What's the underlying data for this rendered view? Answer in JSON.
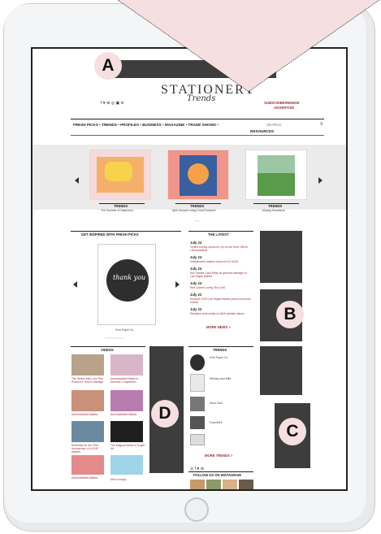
{
  "site": {
    "logo_main": "STATIONERY",
    "logo_script": "Trends",
    "subscribe": "SUBSCRIBE/RENEW",
    "advertise": "ADVERTISE",
    "social_icons": "f ♥ ⊕ ◎ ▣ in"
  },
  "nav": {
    "items": "FRESH PICKS • TRENDS • PROFILES • BUSINESS • MAGAZINE • TRADE SHOWS •",
    "resources": "RESOURCES",
    "search_placeholder": "SEARCH"
  },
  "carousel": {
    "cards": [
      {
        "tag": "TRENDS",
        "caption": "The Summer of Stationery"
      },
      {
        "tag": "TRENDS",
        "caption": "April Showers bring Coral Flowered"
      },
      {
        "tag": "TRENDS",
        "caption": "Moving Mountains"
      }
    ]
  },
  "fresh_picks": {
    "heading": "GET INSPIRED WITH FRESH PICKS",
    "card_text": "thank you",
    "caption": "Fern Paper Co."
  },
  "latest": {
    "heading": "THE LATEST",
    "items": [
      {
        "date": "July 24",
        "text": "Orders buying opens for Up on the Roof Gift for Life fundraiser"
      },
      {
        "date": "July 24",
        "text": "Independent makers return to NY NOW"
      },
      {
        "date": "July 24",
        "text": "IMC names Cara Reilly as general manager of Las Vegas Market"
      },
      {
        "date": "July 24",
        "text": "Red Queen Loving Tea Card"
      },
      {
        "date": "July 22",
        "text": "Summer 2019 Las Vegas Market plans numerous events"
      },
      {
        "date": "July 22",
        "text": "Retailers seek clarity on ADA website claims"
      }
    ],
    "more": "MORE NEWS »"
  },
  "videos": {
    "heading": "VIDEOS",
    "captions": [
      "The Hearts that Love Red Roses for How to Manage",
      "AmericasMart Made in America Competition",
      "AmericasMart Atlanta",
      "AmericasMart Atlanta",
      "Nominate for the 20th Anniversary of LOUIE awards",
      "The Magical World of Sugar Art",
      "AmericasMart Atlanta",
      "Meri Lovejoy"
    ]
  },
  "trends": {
    "heading": "TRENDS",
    "items": [
      "Fern Paper Co.",
      "Whimsy and Wild",
      "Aeon Cars",
      "FrancWell"
    ],
    "more": "MORE TRENDS »",
    "social": "◎ f ♥ ⊕"
  },
  "instagram": {
    "heading": "FOLLOW US ON INSTAGRAM"
  },
  "badges": {
    "a": "A",
    "b": "B",
    "c": "C",
    "d": "D"
  },
  "colors": {
    "placeholder_block": "#3d3d3d",
    "badge_fill": "#f6dfe0",
    "accent": "#9a2f3f"
  }
}
